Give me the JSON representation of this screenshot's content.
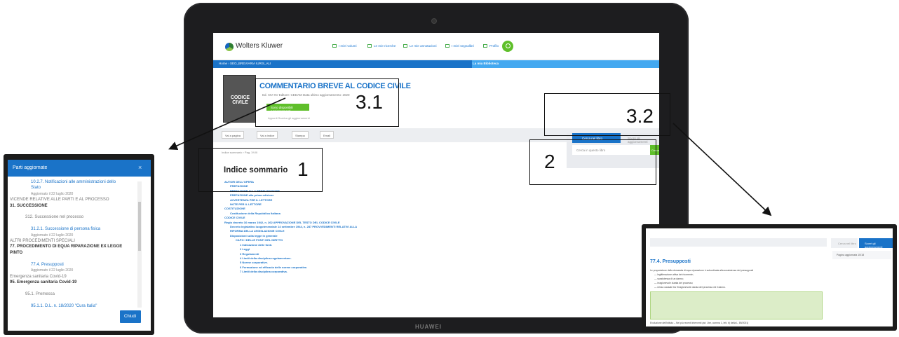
{
  "tablet": {
    "brand": "HUAWEI",
    "header": {
      "logo": "Wolters Kluwer",
      "nav": [
        "I miei volumi",
        "Le mie ricerche",
        "Le mie annotazioni",
        "I miei segnalibri",
        "Profilo"
      ]
    },
    "bluebar": {
      "breadcrumb": "Home  ›  SEO_BREVIARIA IURIS_ALI",
      "library": "La mia  Biblioteca"
    },
    "book": {
      "cover_title": "CODICE CIVILE",
      "title": "COMMENTARIO BREVE AL CODICE CIVILE",
      "meta": "Ed. XIV-XV    Editore: CEDAM    Data ultimo aggiornamento: 2020",
      "update_button": "Sono disponibili aggiornamenti",
      "notes": "Appunti        Scarica gli aggiornamenti"
    },
    "toolbar": [
      "Vai a pagina",
      "Vai a indice",
      "Stampa",
      "Email"
    ],
    "breadcrumb": "Indice sommario  ›  Pag. XVIII",
    "index_title": "Indice sommario",
    "toc": [
      "AUTORI DELL'OPERA",
      "PREFAZIONE",
      "PREFAZIONE ALLA PRIMA EDIZIONE",
      "PREFAZIONE alla prima edizione",
      "AVVERTENZA PER IL LETTORE",
      "NOTE PER IL LETTORE",
      "COSTITUZIONE",
      "Costituzione della Repubblica Italiana",
      "CODICE CIVILE",
      "Regio decreto 16 marzo 1942, n. 262 APPROVAZIONE DEL TESTO DEL CODICE CIVILE",
      "Decreto legislativo luogotenenziale 14 settembre 1944, n. 287 PROVVEDIMENTI RELATIVI ALLA",
      "RIFORMA DELLA LEGISLAZIONE CIVILE",
      "Disposizioni sulla legge in generale",
      "CAPO I DELLE FONTI DEL DIRITTO",
      "1 Indicazione delle fonti.",
      "2 Leggi",
      "3 Regolamenti",
      "4 Limiti della disciplina regolamentare.",
      "5 Norme corporative.",
      "6 Formazione ed efficacia delle norme corporative.",
      "7 Limiti della disciplina corporativa."
    ],
    "panel": {
      "tab_active": "Cerca nel libro",
      "tab_inactive": "Scorri gli aggiornamenti",
      "input_placeholder": "Cerca in questo libro",
      "button": "Cerca"
    }
  },
  "annotations": {
    "label_1": "1",
    "label_2": "2",
    "label_31": "3.1",
    "label_32": "3.2"
  },
  "left_popup": {
    "title": "Parti aggiornate",
    "close_icon": "×",
    "items": [
      {
        "text": "10.2.7. Notificazioni alle amministrazioni dello",
        "style": "blue"
      },
      {
        "text": "Stato",
        "style": "blue"
      },
      {
        "text": "Aggiornato il 22 luglio 2020",
        "style": "small"
      },
      {
        "text": "VICENDE RELATIVE ALLE PARTI E AL PROCESSO",
        "style": "dim"
      },
      {
        "text": "31. SUCCESSIONE",
        "style": "dark"
      },
      {
        "text": "",
        "style": "dim"
      },
      {
        "text": "312. Successione nel processo",
        "style": "dim"
      },
      {
        "text": "",
        "style": "dim"
      },
      {
        "text": "31.2.1. Successione di persona fisica",
        "style": "blue"
      },
      {
        "text": "Aggiornato il 22 luglio 2020",
        "style": "small"
      },
      {
        "text": "ALTRI PROCEDIMENTI SPECIALI",
        "style": "dim"
      },
      {
        "text": "77. PROCEDIMENTO DI EQUA RIPARAZIONE EX LEGGE",
        "style": "dark"
      },
      {
        "text": "PINTO",
        "style": "dark"
      },
      {
        "text": "",
        "style": "dim"
      },
      {
        "text": "77.4. Presupposti",
        "style": "blue"
      },
      {
        "text": "Aggiornato il 22 luglio 2020",
        "style": "small"
      },
      {
        "text": "Emergenza sanitaria Covid-19",
        "style": "dim"
      },
      {
        "text": "95. Emergenza sanitaria Covid-19",
        "style": "dark"
      },
      {
        "text": "",
        "style": "dim"
      },
      {
        "text": "95.1. Premessa",
        "style": "dim"
      },
      {
        "text": "",
        "style": "dim"
      },
      {
        "text": "95.1.1. D.L. n. 18/2020 \"Cura Italia\"",
        "style": "blue"
      }
    ],
    "close_button": "Chiudi"
  },
  "right_popup": {
    "tab1": "Cerca nel libro",
    "tab2": "Scorri gli aggiornamenti",
    "side_row": "Pagina aggiornata 10/18",
    "heading": "77.4. Presupposti",
    "lines": [
      "Le proposizione della domanda di equa riparazione è subordinata alla sussistenza dei presupposti",
      "— legittimazione attiva del ricorrente;",
      "— sussistenza di un danno;",
      "— irragionevole durata del processo;",
      "— nesso causale tra l'irragionevole durata del processo ed il danno.",
      "Evoluzione dell'istituto – Nei più recenti interventi (art. 1ter, comma 1, lett. b) della L. 89/2001)"
    ]
  }
}
